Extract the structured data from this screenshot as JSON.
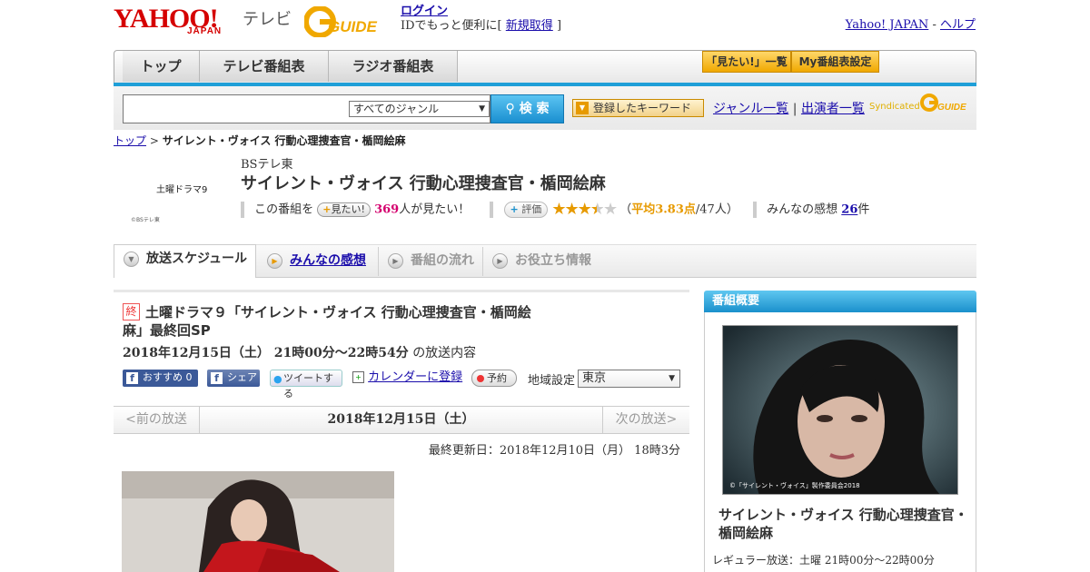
{
  "header": {
    "logo_yahoo": "YAHOO!",
    "logo_japan": "JAPAN",
    "logo_tv": "テレビ",
    "logo_gguide": "GUIDE",
    "login_label": "ログイン",
    "login_sub_text": "IDでもっと便利に[",
    "signup_label": "新規取得",
    "login_sub_close": "]",
    "yahoo_japan_link": "Yahoo! JAPAN",
    "sep": "-",
    "help_link": "ヘルプ"
  },
  "nav": {
    "tabs": [
      {
        "label": "トップ"
      },
      {
        "label": "テレビ番組表"
      },
      {
        "label": "ラジオ番組表"
      }
    ],
    "mitai_list": "「見たい!」一覧",
    "my_settings": "My番組表設定"
  },
  "search": {
    "placeholder": "",
    "genre_selected": "すべてのジャンル",
    "button_label": "検 索",
    "keyword_button": "登録したキーワード",
    "genre_list": "ジャンル一覧",
    "divider": "|",
    "cast_list": "出演者一覧",
    "syndicated": "Syndicated"
  },
  "breadcrumb": {
    "home": "トップ",
    "sep": ">",
    "current": "サイレント・ヴォイス 行動心理捜査官・楯岡絵麻"
  },
  "program": {
    "logo_text": "土曜ドラマ9",
    "logo_copyright": "©BSテレ東",
    "channel": "BSテレ東",
    "title": "サイレント・ヴォイス 行動心理捜査官・楯岡絵麻",
    "want_prefix": "この番組を",
    "want_button": "見たい!",
    "want_count": "369",
    "want_suffix": "人が見たい！",
    "rating_button": "評価",
    "rating_value": 3.83,
    "rating_open": "（",
    "rating_avg": "平均3.83点",
    "rating_count": "/47人）",
    "reviews_prefix": "みんなの感想",
    "reviews_count": "26",
    "reviews_suffix": "件"
  },
  "tabs": [
    {
      "label": "放送スケジュール",
      "state": "active"
    },
    {
      "label": "みんなの感想",
      "state": "link"
    },
    {
      "label": "番組の流れ",
      "state": "disabled"
    },
    {
      "label": "お役立ち情報",
      "state": "disabled"
    }
  ],
  "episode": {
    "end_badge": "終",
    "title": "土曜ドラマ９「サイレント・ヴォイス 行動心理捜査官・楯岡絵麻」最終回SP",
    "date_bold": "2018年12月15日（土） 21時00分～22時54分",
    "date_suffix": "の放送内容",
    "fb_recommend": "おすすめ 0",
    "fb_share": "シェア",
    "tweet": "ツイートする",
    "calendar": "カレンダーに登録",
    "reserve": "予約",
    "region_label": "地域設定",
    "region_value": "東京",
    "prev": "<前の放送",
    "current_date": "2018年12月15日（土）",
    "next": "次の放送>",
    "updated": "最終更新日：2018年12月10日（月） 18時3分"
  },
  "sidebar": {
    "heading": "番組概要",
    "photo_caption": "©「サイレント・ヴォイス」製作委員会2018",
    "title": "サイレント・ヴォイス 行動心理捜査官・楯岡絵麻",
    "regular": "レギュラー放送：土曜 21時00分～22時00分"
  },
  "colors": {
    "accent_blue": "#1f9fd8",
    "yahoo_red": "#d50000",
    "guide_yellow": "#f0a800",
    "link": "#1a0dab",
    "pink_count": "#d4006e"
  }
}
